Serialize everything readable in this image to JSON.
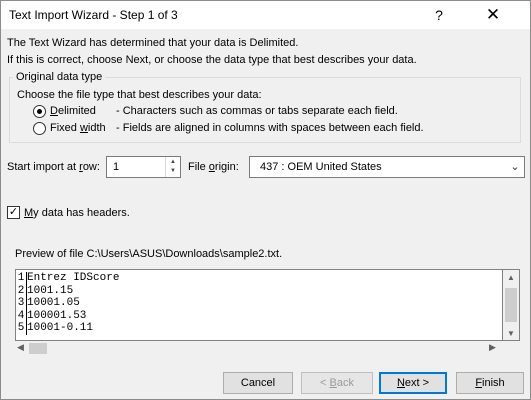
{
  "titlebar": {
    "title": "Text Import Wizard - Step 1 of 3",
    "help_label": "?",
    "close_label": "✕"
  },
  "intro": {
    "line1": "The Text Wizard has determined that your data is Delimited.",
    "line2": "If this is correct, choose Next, or choose the data type that best describes your data."
  },
  "data_type": {
    "legend": "Original data type",
    "prompt": "Choose the file type that best describes your data:",
    "options": [
      {
        "accel": "D",
        "rest": "elimited",
        "desc": "- Characters such as commas or tabs separate each field.",
        "selected": true
      },
      {
        "pre": "Fixed ",
        "accel": "w",
        "rest": "idth",
        "desc": "- Fields are aligned in columns with spaces between each field.",
        "selected": false
      }
    ]
  },
  "start_row": {
    "label_pre": "Start import at ",
    "label_accel": "r",
    "label_post": "ow:",
    "value": "1"
  },
  "file_origin": {
    "label_pre": "File ",
    "label_accel": "o",
    "label_post": "rigin:",
    "value": "437 : OEM United States"
  },
  "headers": {
    "checked": true,
    "check_glyph": "✓",
    "label_accel": "M",
    "label_rest": "y data has headers."
  },
  "preview": {
    "label": "Preview of file C:\\Users\\ASUS\\Downloads\\sample2.txt.",
    "rows": [
      {
        "num": "1",
        "text": "Entrez IDScore"
      },
      {
        "num": "2",
        "text": "1001.15"
      },
      {
        "num": "3",
        "text": "10001.05"
      },
      {
        "num": "4",
        "text": "100001.53"
      },
      {
        "num": "5",
        "text": "10001-0.11"
      }
    ]
  },
  "scroll": {
    "up": "▲",
    "down": "▼",
    "left": "◀",
    "right": "▶"
  },
  "buttons": {
    "cancel": "Cancel",
    "back_accel": "B",
    "back_pre": "< ",
    "back_post": "ack",
    "next_accel": "N",
    "next_post": "ext >",
    "finish_accel": "F",
    "finish_post": "inish"
  }
}
